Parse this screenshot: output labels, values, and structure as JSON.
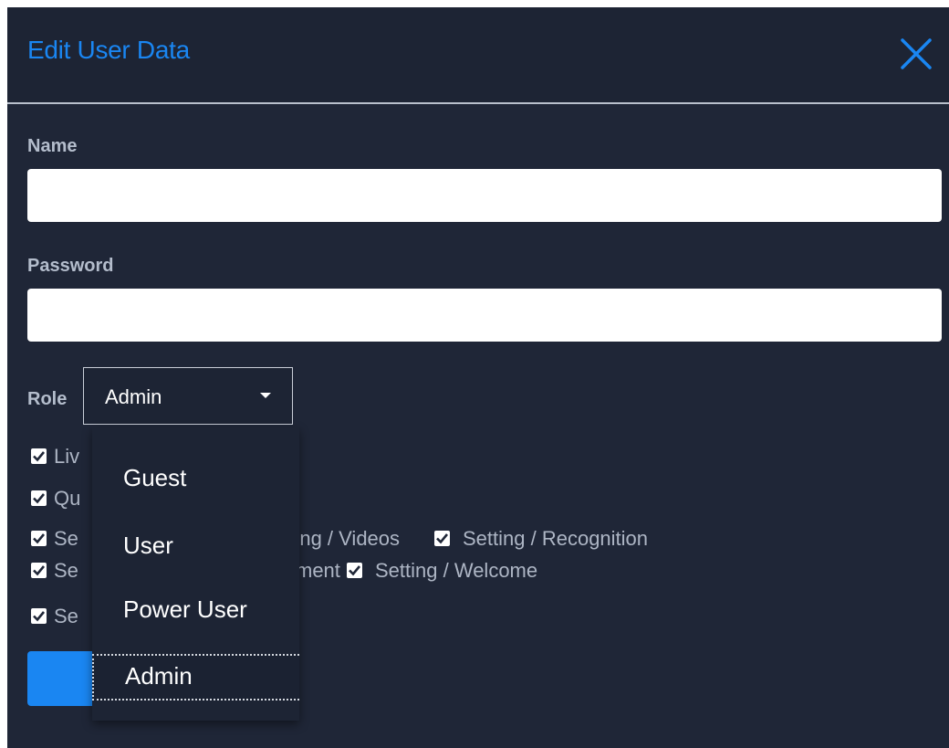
{
  "dialog": {
    "title": "Edit User Data",
    "close_icon": "close-icon",
    "accent_color": "#1a86f2",
    "background_color": "#1f2637"
  },
  "form": {
    "name_label": "Name",
    "name_value": "",
    "password_label": "Password",
    "password_value": "",
    "role_label": "Role",
    "role_value": "Admin"
  },
  "permissions": [
    {
      "label": "Liv",
      "checked": true
    },
    {
      "label": "Qu",
      "checked": true
    },
    {
      "label": "Se",
      "checked": true
    },
    {
      "label": "etting / Videos",
      "checked": true
    },
    {
      "label": "Setting / Recognition",
      "checked": true
    },
    {
      "label": "Se",
      "checked": true
    },
    {
      "label": "ment",
      "checked": true
    },
    {
      "label": "Setting / Welcome",
      "checked": true
    },
    {
      "label": "Se",
      "checked": true
    }
  ],
  "role_menu": {
    "options": [
      "Guest",
      "User",
      "Power User",
      "Admin"
    ],
    "selected": "Admin"
  }
}
